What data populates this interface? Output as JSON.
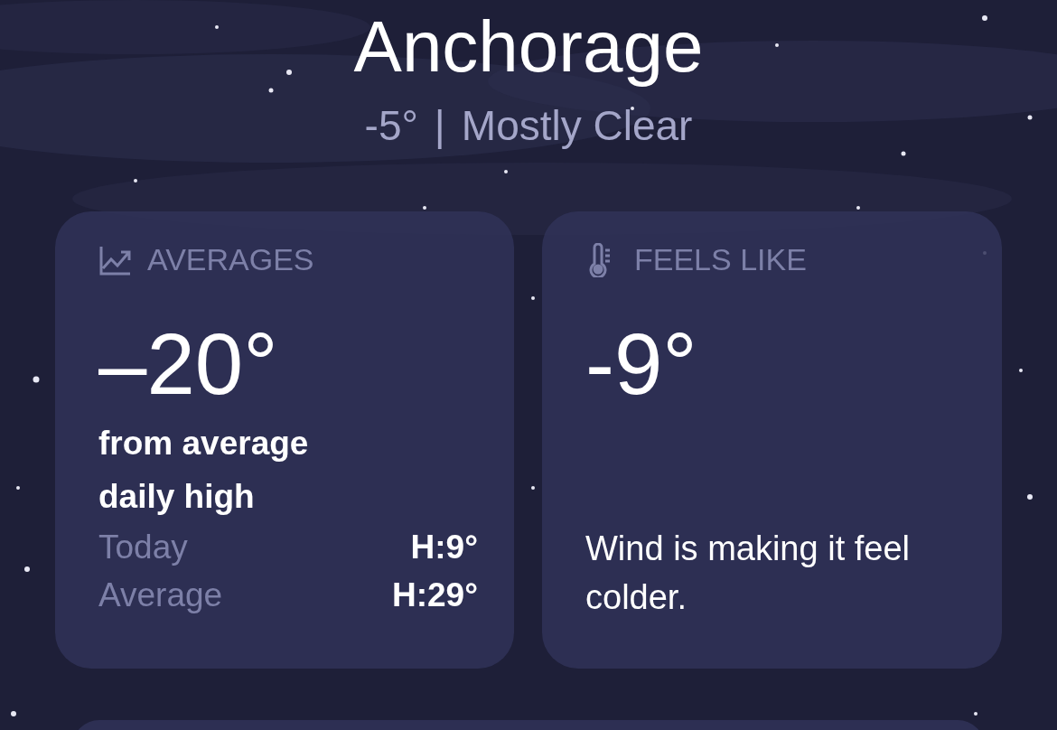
{
  "location": {
    "city": "Anchorage",
    "temperature": "-5°",
    "separator": "|",
    "condition": "Mostly Clear"
  },
  "cards": [
    {
      "kind": "averages",
      "title": "AVERAGES",
      "value": "–20°",
      "caption": "from average daily high",
      "rows": [
        {
          "label": "Today",
          "value": "H:9°"
        },
        {
          "label": "Average",
          "value": "H:29°"
        }
      ]
    },
    {
      "kind": "feels_like",
      "title": "FEELS LIKE",
      "value": "-9°",
      "description": "Wind is making it feel colder."
    }
  ],
  "next_card": {
    "kind": "partial"
  }
}
